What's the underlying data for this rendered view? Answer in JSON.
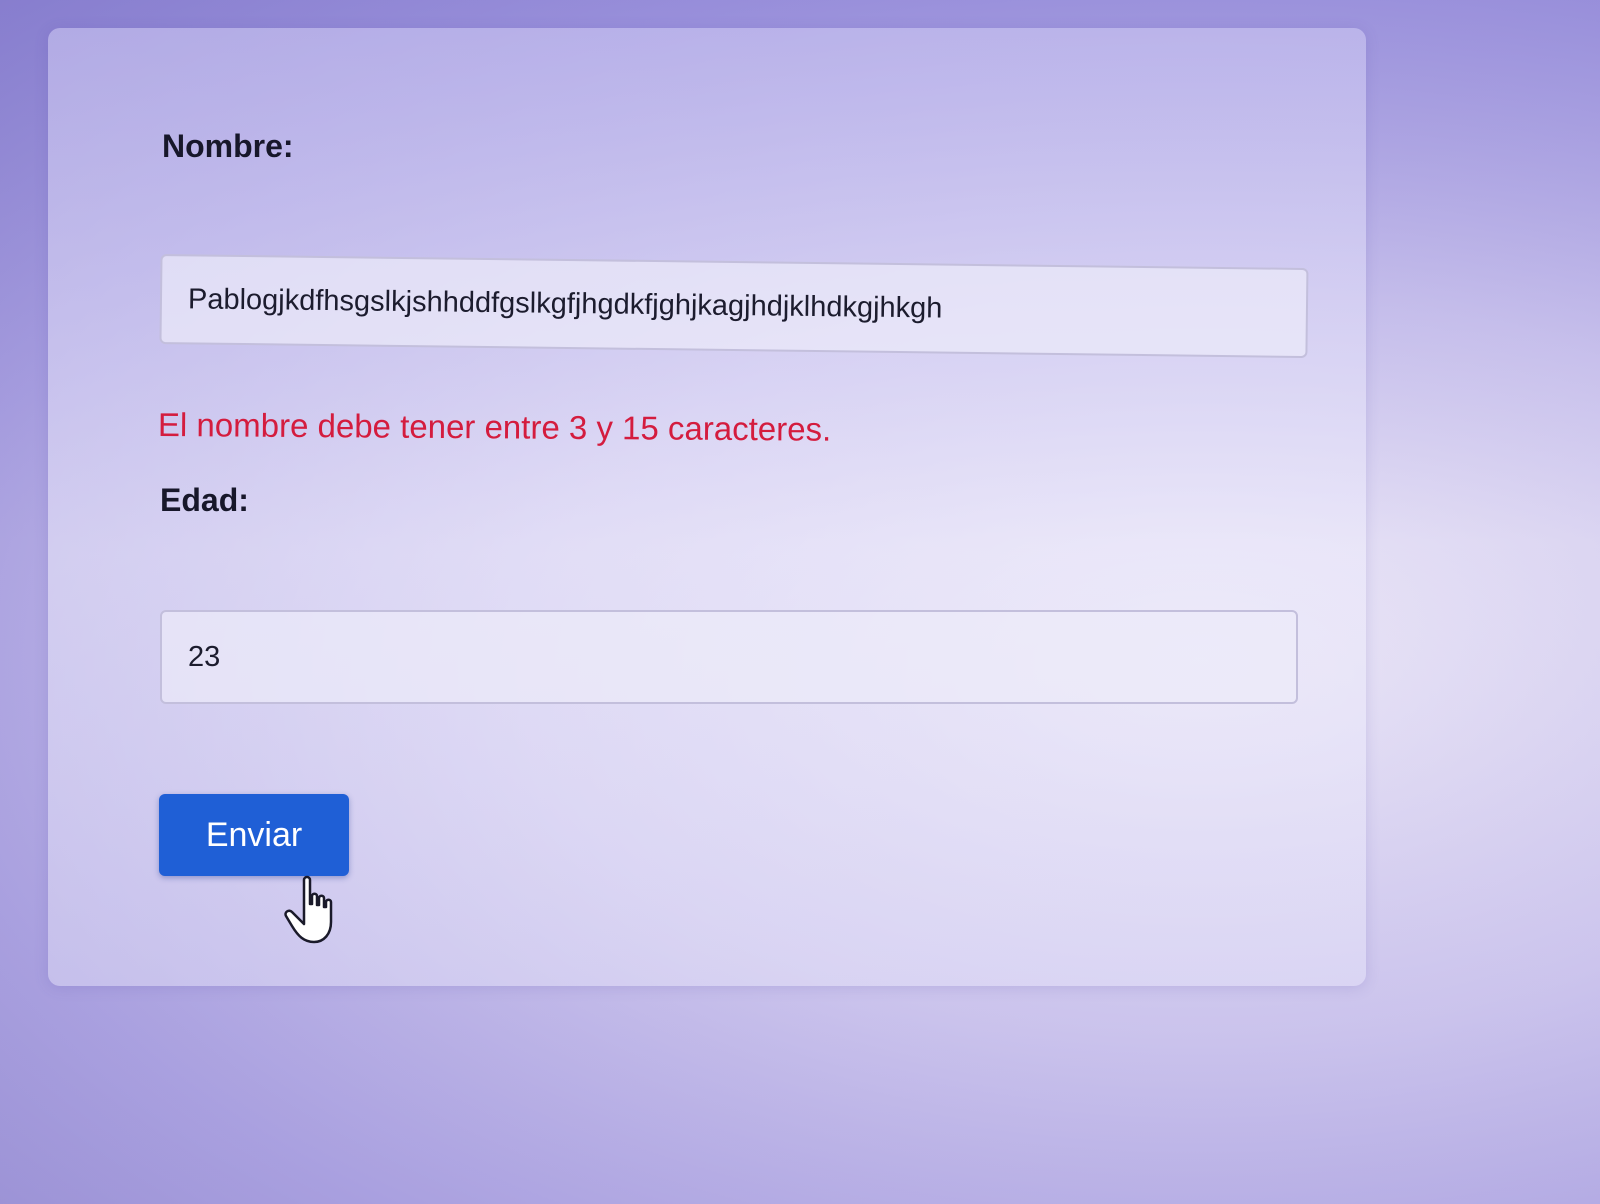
{
  "form": {
    "name_label": "Nombre:",
    "name_value": "Pablogjkdfhsgslkjshhddfgslkgfjhgdkfjghjkagjhdjklhdkgjhkgh",
    "name_error": "El nombre debe tener entre 3 y 15 caracteres.",
    "age_label": "Edad:",
    "age_value": "23",
    "submit_label": "Enviar"
  },
  "colors": {
    "error": "#d41c3e",
    "button": "#1f5fd6",
    "button_text": "#ffffff",
    "label": "#17172a"
  },
  "icons": {
    "cursor": "hand-pointer-icon"
  }
}
